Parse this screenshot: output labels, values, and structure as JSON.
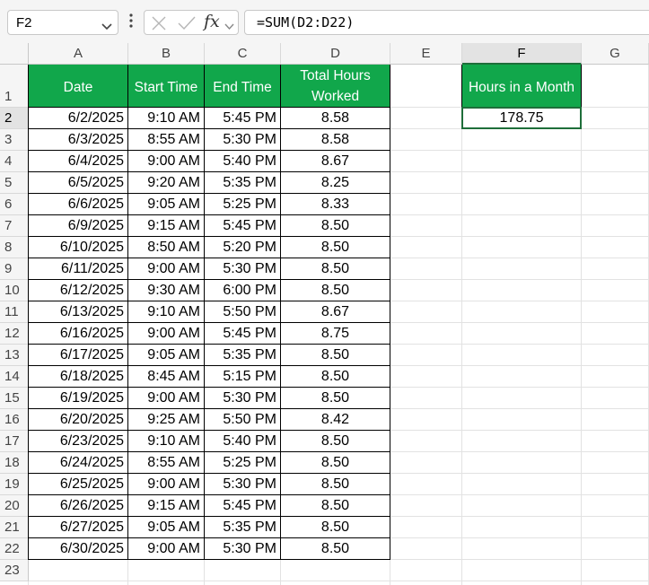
{
  "formula_bar": {
    "name_box": "F2",
    "formula": "=SUM(D2:D22)",
    "fx_label": "fx"
  },
  "columns": [
    "A",
    "B",
    "C",
    "D",
    "E",
    "F",
    "G"
  ],
  "rows": [
    "1",
    "2",
    "3",
    "4",
    "5",
    "6",
    "7",
    "8",
    "9",
    "10",
    "11",
    "12",
    "13",
    "14",
    "15",
    "16",
    "17",
    "18",
    "19",
    "20",
    "21",
    "22",
    "23"
  ],
  "headers": {
    "date": "Date",
    "start_time": "Start Time",
    "end_time": "End Time",
    "total_hours_line1": "Total Hours",
    "total_hours_line2": "Worked",
    "hours_in_month": "Hours in a Month"
  },
  "summary": {
    "hours_in_month_value": "178.75"
  },
  "colors": {
    "header_green": "#11a74b",
    "selection": "#1e6e3a"
  },
  "table": [
    {
      "date": "6/2/2025",
      "start": "9:10 AM",
      "end": "5:45 PM",
      "hours": "8.58"
    },
    {
      "date": "6/3/2025",
      "start": "8:55 AM",
      "end": "5:30 PM",
      "hours": "8.58"
    },
    {
      "date": "6/4/2025",
      "start": "9:00 AM",
      "end": "5:40 PM",
      "hours": "8.67"
    },
    {
      "date": "6/5/2025",
      "start": "9:20 AM",
      "end": "5:35 PM",
      "hours": "8.25"
    },
    {
      "date": "6/6/2025",
      "start": "9:05 AM",
      "end": "5:25 PM",
      "hours": "8.33"
    },
    {
      "date": "6/9/2025",
      "start": "9:15 AM",
      "end": "5:45 PM",
      "hours": "8.50"
    },
    {
      "date": "6/10/2025",
      "start": "8:50 AM",
      "end": "5:20 PM",
      "hours": "8.50"
    },
    {
      "date": "6/11/2025",
      "start": "9:00 AM",
      "end": "5:30 PM",
      "hours": "8.50"
    },
    {
      "date": "6/12/2025",
      "start": "9:30 AM",
      "end": "6:00 PM",
      "hours": "8.50"
    },
    {
      "date": "6/13/2025",
      "start": "9:10 AM",
      "end": "5:50 PM",
      "hours": "8.67"
    },
    {
      "date": "6/16/2025",
      "start": "9:00 AM",
      "end": "5:45 PM",
      "hours": "8.75"
    },
    {
      "date": "6/17/2025",
      "start": "9:05 AM",
      "end": "5:35 PM",
      "hours": "8.50"
    },
    {
      "date": "6/18/2025",
      "start": "8:45 AM",
      "end": "5:15 PM",
      "hours": "8.50"
    },
    {
      "date": "6/19/2025",
      "start": "9:00 AM",
      "end": "5:30 PM",
      "hours": "8.50"
    },
    {
      "date": "6/20/2025",
      "start": "9:25 AM",
      "end": "5:50 PM",
      "hours": "8.42"
    },
    {
      "date": "6/23/2025",
      "start": "9:10 AM",
      "end": "5:40 PM",
      "hours": "8.50"
    },
    {
      "date": "6/24/2025",
      "start": "8:55 AM",
      "end": "5:25 PM",
      "hours": "8.50"
    },
    {
      "date": "6/25/2025",
      "start": "9:00 AM",
      "end": "5:30 PM",
      "hours": "8.50"
    },
    {
      "date": "6/26/2025",
      "start": "9:15 AM",
      "end": "5:45 PM",
      "hours": "8.50"
    },
    {
      "date": "6/27/2025",
      "start": "9:05 AM",
      "end": "5:35 PM",
      "hours": "8.50"
    },
    {
      "date": "6/30/2025",
      "start": "9:00 AM",
      "end": "5:30 PM",
      "hours": "8.50"
    }
  ]
}
